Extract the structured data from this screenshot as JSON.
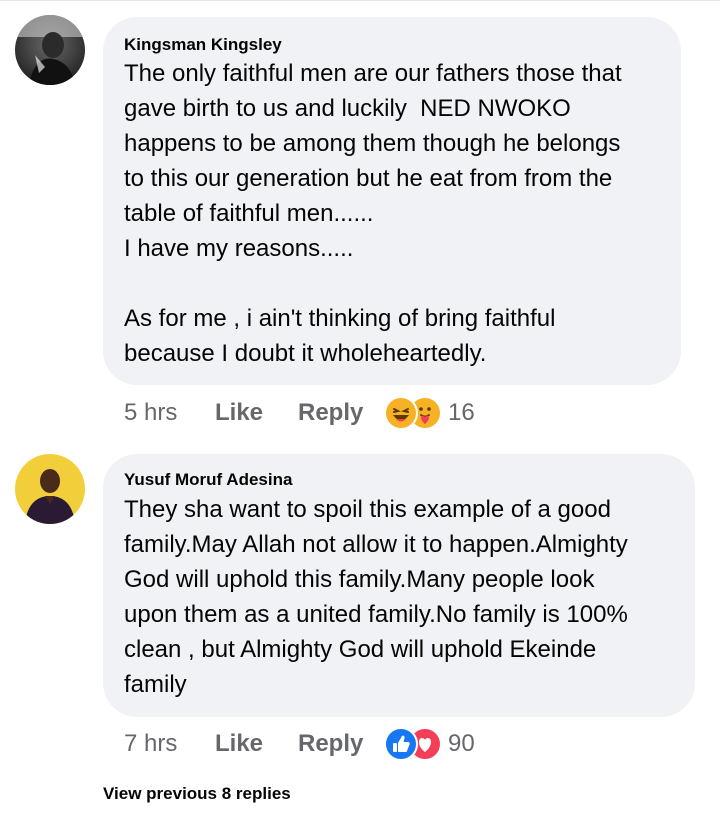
{
  "comments": [
    {
      "author": "Kingsman Kingsley",
      "text": "The only faithful men are our fathers those that\ngave birth to us and luckily  NED NWOKO\nhappens to be among them though he belongs\nto this our generation but he eat from from the\ntable of faithful men......\nI have my reasons.....\n\nAs for me , i ain't thinking of bring faithful\nbecause I doubt it wholeheartedly.",
      "time": "5 hrs",
      "like_label": "Like",
      "reply_label": "Reply",
      "reactions": [
        "haha",
        "care"
      ],
      "reaction_count": "16"
    },
    {
      "author": "Yusuf Moruf Adesina",
      "text": "They sha want to spoil this example of a good\nfamily.May Allah not allow it to happen.Almighty\nGod will uphold this family.Many people look\nupon them as a united family.No family is 100%\nclean , but Almighty God will uphold Ekeinde\nfamily",
      "time": "7 hrs",
      "like_label": "Like",
      "reply_label": "Reply",
      "reactions": [
        "like",
        "love"
      ],
      "reaction_count": "90"
    }
  ],
  "view_previous": "View previous 8 replies",
  "colors": {
    "bubble": "#f0f2f5",
    "meta_text": "#65676b",
    "like_blue": "#1877f2",
    "love_red": "#f33e58",
    "haha_yellow": "#f7b125"
  }
}
